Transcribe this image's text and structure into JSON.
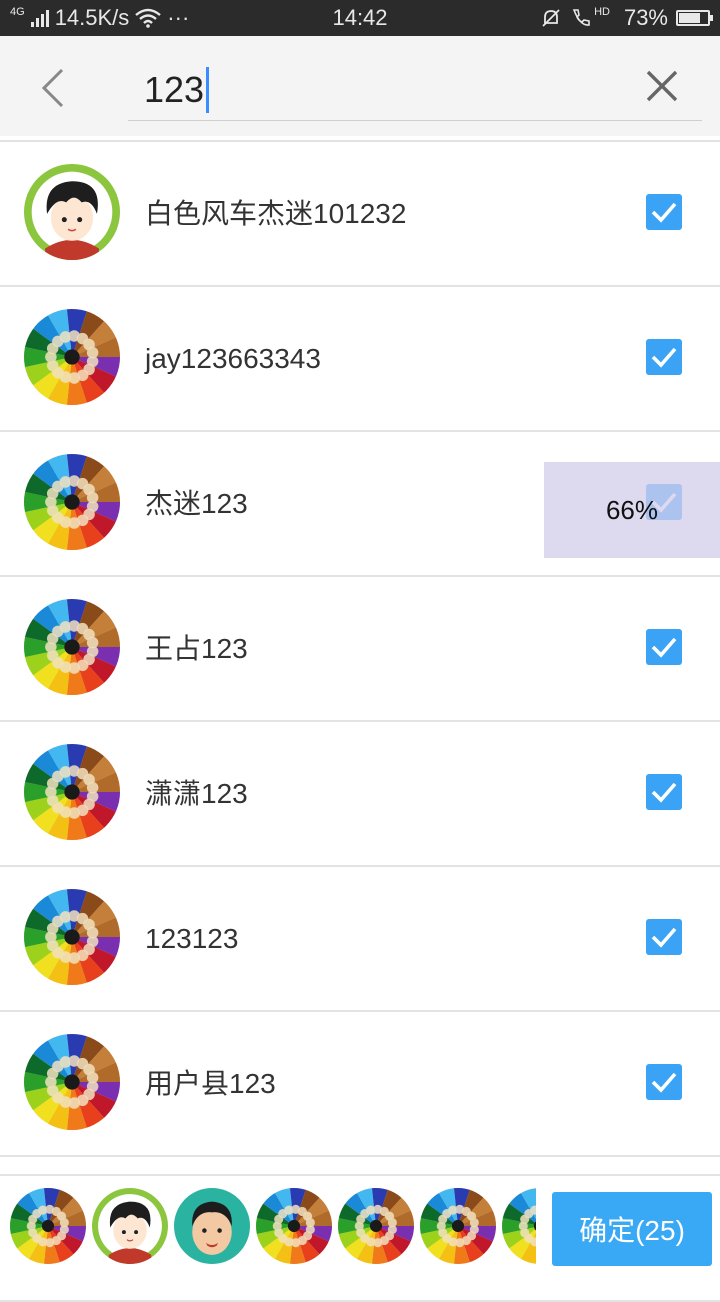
{
  "status_bar": {
    "network": "4G",
    "speed": "14.5K/s",
    "more": "···",
    "time": "14:42",
    "hd": "HD",
    "battery": "73%",
    "battery_level": 0.73
  },
  "search": {
    "query": "123"
  },
  "contacts": [
    {
      "name": "白色风车杰迷101232",
      "avatar": "cartoon-boy",
      "checked": true
    },
    {
      "name": "jay123663343",
      "avatar": "colored-pencils",
      "checked": true
    },
    {
      "name": "杰迷123",
      "avatar": "colored-pencils",
      "checked": true
    },
    {
      "name": "王占123",
      "avatar": "colored-pencils",
      "checked": true
    },
    {
      "name": "潇潇123",
      "avatar": "colored-pencils",
      "checked": true
    },
    {
      "name": "123123",
      "avatar": "colored-pencils",
      "checked": true
    },
    {
      "name": "用户县123",
      "avatar": "colored-pencils",
      "checked": true
    }
  ],
  "progress_overlay": {
    "text": "66%",
    "value": 0.66
  },
  "selected_avatars": [
    "colored-pencils",
    "cartoon-boy",
    "cartoon-man",
    "colored-pencils",
    "colored-pencils",
    "colored-pencils",
    "colored-pencils"
  ],
  "confirm_button": {
    "label": "确定(25)"
  },
  "colors": {
    "accent": "#3aa3f5",
    "status_bar": "#2b2b2b",
    "header_bg": "#f4f4f4"
  }
}
